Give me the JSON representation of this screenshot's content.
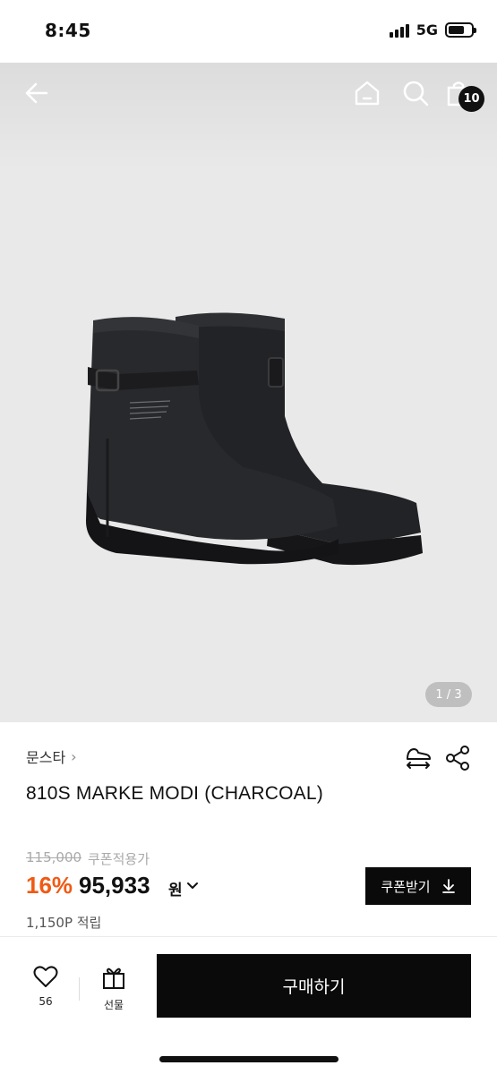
{
  "status_bar": {
    "time": "8:45",
    "network": "5G"
  },
  "nav": {
    "cart_count": "10"
  },
  "image": {
    "pager": "1 / 3"
  },
  "product": {
    "brand": "문스타",
    "brand_arrow": "›",
    "title": "810S MARKE MODI (CHARCOAL)",
    "original_price": "115,000",
    "coupon_applied_label": "쿠폰적용가",
    "discount": "16%",
    "price": "95,933",
    "currency": "원",
    "coupon_button": "쿠폰받기",
    "points": "1,150P 적립"
  },
  "bottom_bar": {
    "like_count": "56",
    "gift_label": "선물",
    "buy_label": "구매하기"
  },
  "colors": {
    "accent": "#f05a14",
    "primary": "#0a0a0a",
    "image_bg": "#e9e9e9"
  }
}
